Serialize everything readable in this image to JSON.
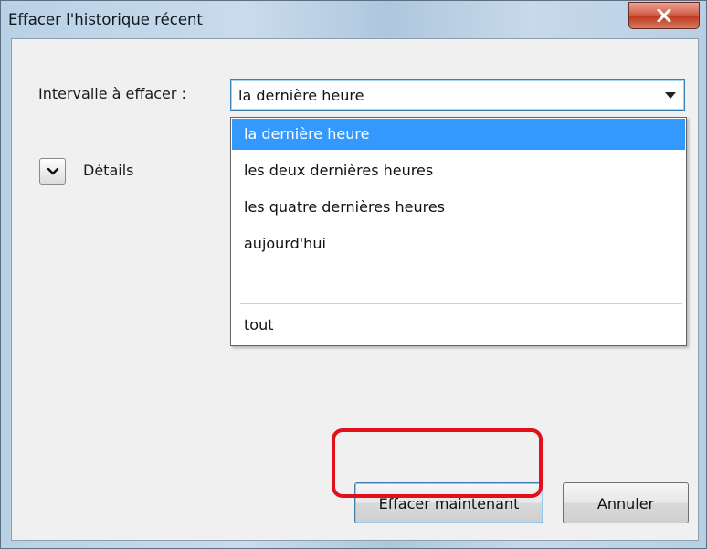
{
  "window": {
    "title": "Effacer l'historique récent"
  },
  "interval": {
    "label": "Intervalle à effacer :",
    "selected_value": "la dernière heure",
    "options": [
      "la dernière heure",
      "les deux dernières heures",
      "les quatre dernières heures",
      "aujourd'hui",
      "tout"
    ]
  },
  "details": {
    "label": "Détails"
  },
  "buttons": {
    "clear_now": "Effacer maintenant",
    "cancel": "Annuler"
  },
  "colors": {
    "selection": "#3399ff",
    "highlight_annotation": "#e0101c",
    "close_button": "#c8492f"
  },
  "icons": {
    "close": "close-icon",
    "dropdown": "dropdown-arrow-icon",
    "expand": "chevron-down-icon"
  }
}
